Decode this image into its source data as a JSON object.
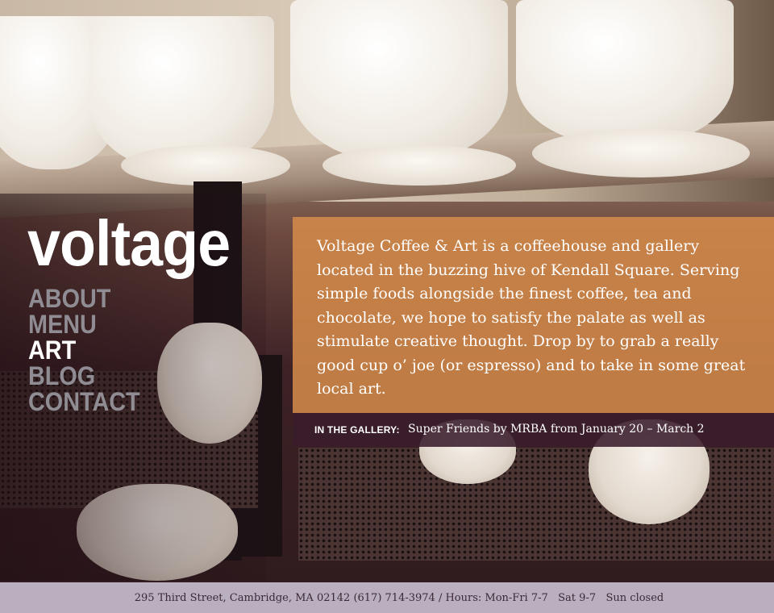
{
  "site": {
    "logo": "voltage"
  },
  "nav": {
    "items": [
      {
        "label": "ABOUT"
      },
      {
        "label": "MENU"
      },
      {
        "label": "ART"
      },
      {
        "label": "BLOG"
      },
      {
        "label": "CONTACT"
      }
    ],
    "active": "ART"
  },
  "intro": {
    "text": "Voltage Coffee & Art is a coffeehouse and gallery located in the buzzing hive of Kendall Square. Serving simple foods alongside the finest coffee, tea and chocolate, we hope to satisfy the palate as well as stimulate creative thought. Drop by to grab a really good cup o’ joe (or espresso) and to take in some great local art."
  },
  "gallery": {
    "label": "IN THE GALLERY:",
    "text": "Super Friends by MRBA from January 20 – March 2"
  },
  "footer": {
    "text": "295 Third Street, Cambridge, MA 02142 (617) 714-3974 / Hours: Mon-Fri 7-7   Sat 9-7   Sun closed"
  },
  "colors": {
    "intro_panel": "#d68c4a",
    "gallery_bar": "#3a1c2c",
    "footer_bar": "#cdc4d6",
    "nav_inactive": "#8f8d93",
    "nav_active": "#ffffff"
  }
}
